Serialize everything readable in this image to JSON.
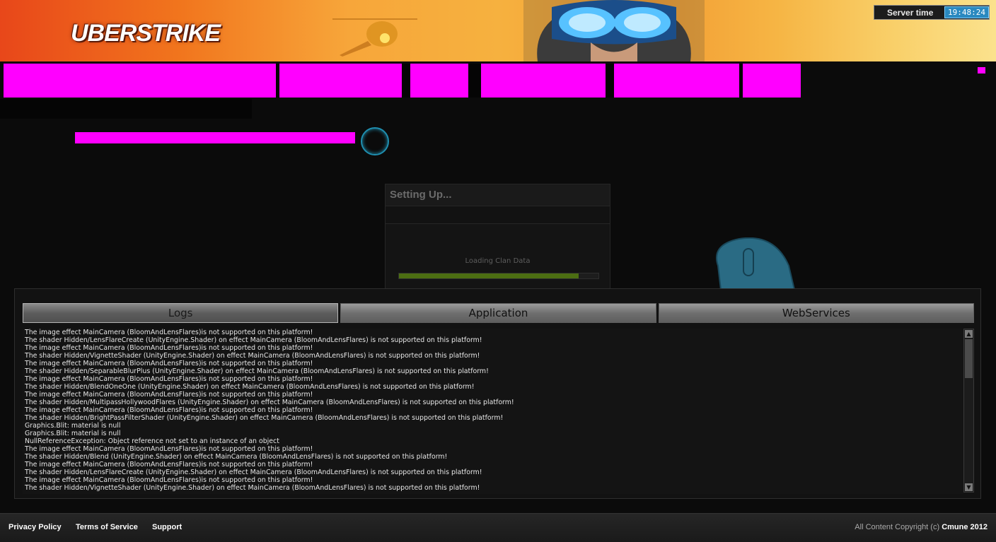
{
  "header": {
    "logo_text": "UBERSTRIKE",
    "server_time_label": "Server time",
    "server_time_value": "19:48:24"
  },
  "setup_panel": {
    "title": "Setting Up...",
    "status": "Loading Clan Data",
    "progress": 0.9
  },
  "console": {
    "tabs": [
      {
        "label": "Logs",
        "active": true
      },
      {
        "label": "Application",
        "active": false
      },
      {
        "label": "WebServices",
        "active": false
      }
    ],
    "lines": [
      "The image effect MainCamera (BloomAndLensFlares)is not supported on this platform!",
      "The shader Hidden/LensFlareCreate (UnityEngine.Shader) on effect MainCamera (BloomAndLensFlares) is not supported on this platform!",
      "The image effect MainCamera (BloomAndLensFlares)is not supported on this platform!",
      "The shader Hidden/VignetteShader (UnityEngine.Shader) on effect MainCamera (BloomAndLensFlares) is not supported on this platform!",
      "The image effect MainCamera (BloomAndLensFlares)is not supported on this platform!",
      "The shader Hidden/SeparableBlurPlus (UnityEngine.Shader) on effect MainCamera (BloomAndLensFlares) is not supported on this platform!",
      "The image effect MainCamera (BloomAndLensFlares)is not supported on this platform!",
      "The shader Hidden/BlendOneOne (UnityEngine.Shader) on effect MainCamera (BloomAndLensFlares) is not supported on this platform!",
      "The image effect MainCamera (BloomAndLensFlares)is not supported on this platform!",
      "The shader Hidden/MultipassHollywoodFlares (UnityEngine.Shader) on effect MainCamera (BloomAndLensFlares) is not supported on this platform!",
      "The image effect MainCamera (BloomAndLensFlares)is not supported on this platform!",
      "The shader Hidden/BrightPassFilterShader (UnityEngine.Shader) on effect MainCamera (BloomAndLensFlares) is not supported on this platform!",
      "Graphics.Blit: material is null",
      "Graphics.Blit: material is null",
      "NullReferenceException: Object reference not set to an instance of an object",
      "The image effect MainCamera (BloomAndLensFlares)is not supported on this platform!",
      "The shader Hidden/Blend (UnityEngine.Shader) on effect MainCamera (BloomAndLensFlares) is not supported on this platform!",
      "The image effect MainCamera (BloomAndLensFlares)is not supported on this platform!",
      "The shader Hidden/LensFlareCreate (UnityEngine.Shader) on effect MainCamera (BloomAndLensFlares) is not supported on this platform!",
      "The image effect MainCamera (BloomAndLensFlares)is not supported on this platform!",
      "The shader Hidden/VignetteShader (UnityEngine.Shader) on effect MainCamera (BloomAndLensFlares) is not supported on this platform!"
    ]
  },
  "footer": {
    "links": [
      "Privacy Policy",
      "Terms of Service",
      "Support"
    ],
    "copyright_prefix": "All Content Copyright (c) ",
    "copyright_owner": "Cmune 2012"
  },
  "colors": {
    "missing_texture": "#ff00ff",
    "progress_fill": "#4c6e12",
    "accent_blue": "#2a89c0"
  }
}
